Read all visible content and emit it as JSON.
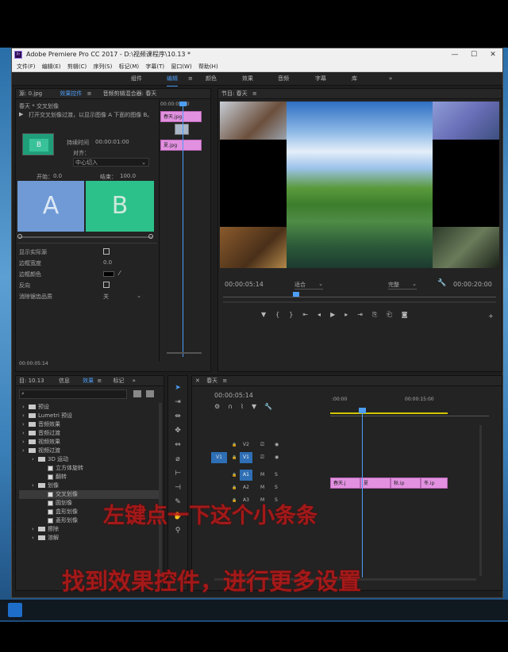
{
  "window": {
    "title": "Adobe Premiere Pro CC 2017 - D:\\视频课程序\\10.13 *",
    "app_icon": "Pr"
  },
  "menu": [
    "文件(F)",
    "编辑(E)",
    "剪辑(C)",
    "序列(S)",
    "标记(M)",
    "字幕(T)",
    "窗口(W)",
    "帮助(H)"
  ],
  "workspaces": [
    "组件",
    "编辑",
    "颜色",
    "效果",
    "音频",
    "字幕",
    "库"
  ],
  "effect_controls": {
    "tabs": [
      "源: 0.jpg",
      "效果控件",
      "音频剪辑混合器: 春天"
    ],
    "clip_path": "春天 * 交叉划像",
    "desc": "打开交叉划像过渡，以显示图像 A 下面的图像 B。",
    "duration_label": "持续时间",
    "duration": "00:00:01:00",
    "align_label": "对齐：",
    "align_value": "中心切入",
    "start_label": "开始：",
    "start_value": "0.0",
    "end_label": "结束：",
    "end_value": "100.0",
    "preview_a": "A",
    "preview_b": "B",
    "thumb_b": "B",
    "show_source": "显示实际源",
    "border_width_label": "边框宽度",
    "border_width": "0.0",
    "border_color_label": "边框颜色",
    "reverse_label": "反向",
    "aa_label": "消除锯齿品质",
    "aa_value": "关",
    "timecode": "00:00:05:14",
    "mini_time": "00:00:05:00",
    "mini_clip1": "春天.jpg",
    "mini_clip2": "夏.jpg"
  },
  "program": {
    "title": "节目: 春天",
    "timecode": "00:00:05:14",
    "fit": "适合",
    "quality": "完整",
    "duration": "00:00:20:00"
  },
  "project": {
    "tabs": [
      "目: 10.13",
      "信息",
      "效果",
      "标记"
    ],
    "tree": [
      {
        "label": "预设",
        "depth": 0,
        "kind": "folder"
      },
      {
        "label": "Lumetri 预设",
        "depth": 0,
        "kind": "folder"
      },
      {
        "label": "音频效果",
        "depth": 0,
        "kind": "folder"
      },
      {
        "label": "音频过渡",
        "depth": 0,
        "kind": "folder"
      },
      {
        "label": "视频效果",
        "depth": 0,
        "kind": "folder"
      },
      {
        "label": "视频过渡",
        "depth": 0,
        "kind": "folder"
      },
      {
        "label": "3D 运动",
        "depth": 1,
        "kind": "folder"
      },
      {
        "label": "立方体旋转",
        "depth": 2,
        "kind": "fx"
      },
      {
        "label": "翻转",
        "depth": 2,
        "kind": "fx"
      },
      {
        "label": "划像",
        "depth": 1,
        "kind": "folder"
      },
      {
        "label": "交叉划像",
        "depth": 2,
        "kind": "fx",
        "selected": true
      },
      {
        "label": "圆划像",
        "depth": 2,
        "kind": "fx"
      },
      {
        "label": "盒形划像",
        "depth": 2,
        "kind": "fx"
      },
      {
        "label": "菱形划像",
        "depth": 2,
        "kind": "fx"
      },
      {
        "label": "擦除",
        "depth": 1,
        "kind": "folder"
      },
      {
        "label": "溶解",
        "depth": 1,
        "kind": "folder"
      }
    ]
  },
  "timeline": {
    "tab": "春天",
    "timecode": "00:00:05:14",
    "ruler": [
      ":00:00",
      "00:00:15:00"
    ],
    "tracks": [
      "V2",
      "V1",
      "A1",
      "A2",
      "A3"
    ],
    "source_patch": "V1",
    "clips": [
      "春天.j",
      "夏",
      "秋.ip",
      "冬.ip"
    ]
  },
  "overlay": {
    "line1": "左键点一下这个小条条",
    "line2": "找到效果控件，进行更多设置"
  },
  "colors": {
    "accent": "#4d9ef7",
    "clip": "#e291e0",
    "overlay": "#c01818"
  }
}
